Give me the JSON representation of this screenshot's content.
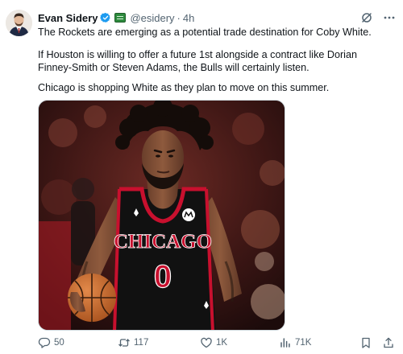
{
  "author": {
    "name": "Evan Sidery",
    "handle": "@esidery",
    "separator": "·",
    "time": "4h"
  },
  "tweet": {
    "paragraphs": [
      "The Rockets are emerging as a potential trade destination for Coby White.",
      "If Houston is willing to offer a future 1st alongside a contract like Dorian Finney-Smith or Steven Adams, the Bulls will certainly listen.",
      "Chicago is shopping White as they plan to move on this summer."
    ]
  },
  "media": {
    "jersey_text": "CHICAGO",
    "jersey_number": "0"
  },
  "metrics": {
    "replies": "50",
    "reposts": "117",
    "likes": "1K",
    "views": "71K"
  },
  "icons": {
    "verified": "verified-badge-icon",
    "affiliate": "affiliate-badge-icon",
    "grok": "grok-icon",
    "more": "more-icon",
    "reply": "reply-icon",
    "repost": "repost-icon",
    "like": "like-icon",
    "views": "views-icon",
    "bookmark": "bookmark-icon",
    "share": "share-icon"
  },
  "colors": {
    "text": "#0f1419",
    "secondary": "#536471",
    "verified": "#1d9bf0",
    "bulls_red": "#c8102e",
    "jersey_black": "#111111"
  }
}
